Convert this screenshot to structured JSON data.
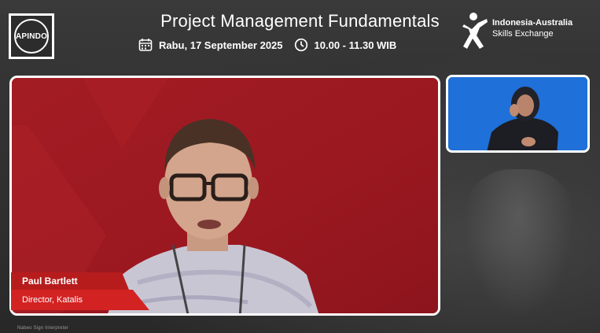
{
  "header": {
    "logo_left_text": "APINDO",
    "title": "Project Management Fundamentals",
    "date_text": "Rabu, 17 September 2025",
    "time_text": "10.00 - 11.30 WIB",
    "partner_line1": "Indonesia-Australia",
    "partner_line2": "Skills Exchange",
    "icons": {
      "date": "calendar-icon",
      "time": "clock-icon"
    }
  },
  "speaker": {
    "name": "Paul Bartlett",
    "role": "Director, Katalis"
  },
  "footer": {
    "caption": "Nabeo Sign Interpreter"
  },
  "colors": {
    "speaker_bg": "#9e1a22",
    "name_band": "#b71c1c",
    "role_band": "#d32222",
    "interpreter_bg": "#1e6fd6"
  }
}
